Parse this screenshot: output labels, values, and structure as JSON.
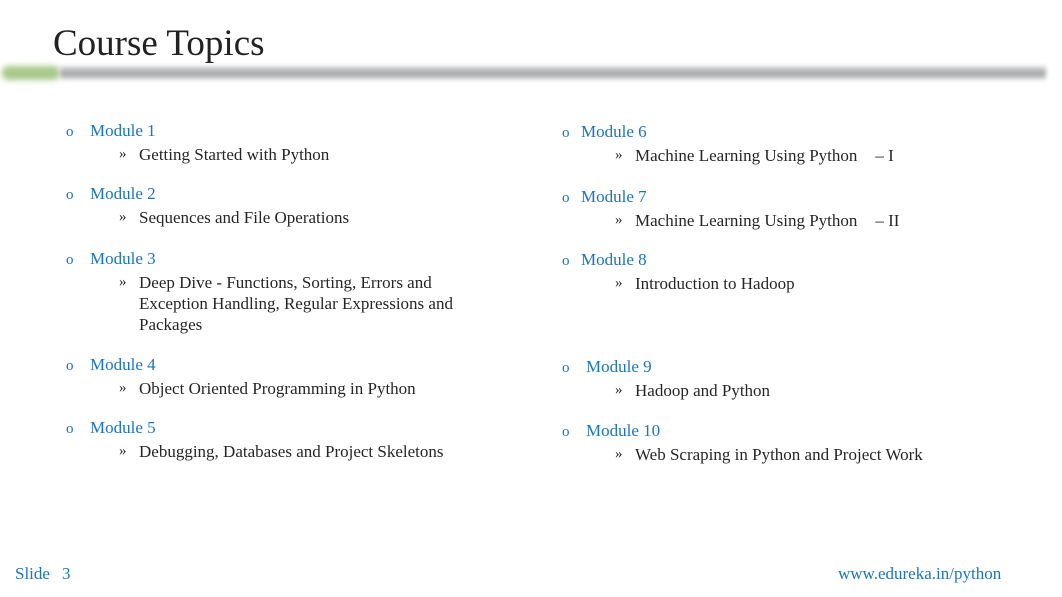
{
  "slide": {
    "title": "Course Topics",
    "accent_color": "#1b75bc",
    "bar_colors": {
      "green": "#a9c98c",
      "gray": "#a6a8aa"
    }
  },
  "modules": [
    {
      "name": "Module 1",
      "topic": "Getting Started with Python",
      "suffix": ""
    },
    {
      "name": "Module 2",
      "topic": "Sequences and File Operations",
      "suffix": ""
    },
    {
      "name": "Module 3",
      "topic": "Deep Dive - Functions, Sorting, Errors and Exception Handling, Regular Expressions and Packages",
      "suffix": ""
    },
    {
      "name": "Module 4",
      "topic": "Object Oriented Programming in Python",
      "suffix": ""
    },
    {
      "name": "Module 5",
      "topic": "Debugging, Databases and Project Skeletons",
      "suffix": ""
    },
    {
      "name": "Module 6",
      "topic": "Machine Learning Using Python",
      "suffix": "– I"
    },
    {
      "name": "Module 7",
      "topic": "Machine Learning Using Python",
      "suffix": "– II"
    },
    {
      "name": "Module 8",
      "topic": "Introduction to Hadoop",
      "suffix": ""
    },
    {
      "name": "Module 9",
      "topic": "Hadoop and Python",
      "suffix": ""
    },
    {
      "name": "Module 10",
      "topic": "Web Scraping in Python and Project Work",
      "suffix": ""
    }
  ],
  "bullets": {
    "module": "o",
    "topic": "»"
  },
  "footer": {
    "slide_label": "Slide",
    "slide_number": "3",
    "url": "www.edureka.in/python"
  }
}
